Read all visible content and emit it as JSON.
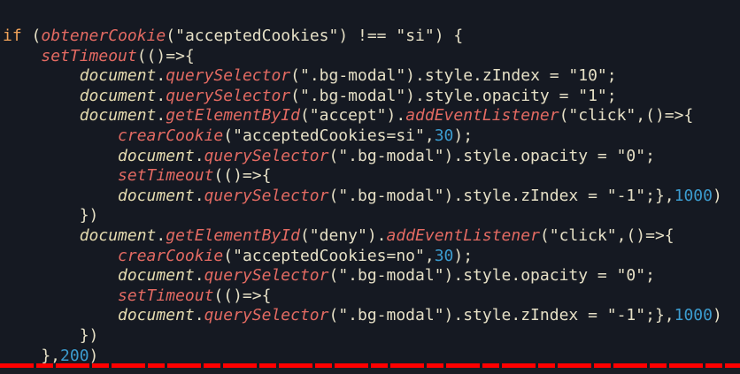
{
  "code_lines": [
    [
      [
        "kw",
        "if"
      ],
      [
        "pl",
        " ("
      ],
      [
        "fn",
        "obtenerCookie"
      ],
      [
        "pl",
        "(\"acceptedCookies\") !== \"si\") {"
      ]
    ],
    [
      [
        "pl",
        "    "
      ],
      [
        "fn",
        "setTimeout"
      ],
      [
        "pl",
        "(()=>{"
      ]
    ],
    [
      [
        "pl",
        "        "
      ],
      [
        "obj",
        "document"
      ],
      [
        "pl",
        "."
      ],
      [
        "fn",
        "querySelector"
      ],
      [
        "pl",
        "(\".bg-modal\").style.zIndex = \"10\";"
      ]
    ],
    [
      [
        "pl",
        "        "
      ],
      [
        "obj",
        "document"
      ],
      [
        "pl",
        "."
      ],
      [
        "fn",
        "querySelector"
      ],
      [
        "pl",
        "(\".bg-modal\").style.opacity = \"1\";"
      ]
    ],
    [
      [
        "pl",
        "        "
      ],
      [
        "obj",
        "document"
      ],
      [
        "pl",
        "."
      ],
      [
        "fn",
        "getElementById"
      ],
      [
        "pl",
        "(\"accept\")."
      ],
      [
        "fn",
        "addEventListener"
      ],
      [
        "pl",
        "(\"click\",()=>{"
      ]
    ],
    [
      [
        "pl",
        "            "
      ],
      [
        "fn",
        "crearCookie"
      ],
      [
        "pl",
        "(\"acceptedCookies=si\","
      ],
      [
        "num",
        "30"
      ],
      [
        "pl",
        ");"
      ]
    ],
    [
      [
        "pl",
        "            "
      ],
      [
        "obj",
        "document"
      ],
      [
        "pl",
        "."
      ],
      [
        "fn",
        "querySelector"
      ],
      [
        "pl",
        "(\".bg-modal\").style.opacity = \"0\";"
      ]
    ],
    [
      [
        "pl",
        "            "
      ],
      [
        "fn",
        "setTimeout"
      ],
      [
        "pl",
        "(()=>{"
      ]
    ],
    [
      [
        "pl",
        "            "
      ],
      [
        "obj",
        "document"
      ],
      [
        "pl",
        "."
      ],
      [
        "fn",
        "querySelector"
      ],
      [
        "pl",
        "(\".bg-modal\").style.zIndex = \"-1\";},"
      ],
      [
        "num",
        "1000"
      ],
      [
        "pl",
        ")"
      ]
    ],
    [
      [
        "pl",
        "        })"
      ]
    ],
    [
      [
        "pl",
        "        "
      ],
      [
        "obj",
        "document"
      ],
      [
        "pl",
        "."
      ],
      [
        "fn",
        "getElementById"
      ],
      [
        "pl",
        "(\"deny\")."
      ],
      [
        "fn",
        "addEventListener"
      ],
      [
        "pl",
        "(\"click\",()=>{"
      ]
    ],
    [
      [
        "pl",
        "            "
      ],
      [
        "fn",
        "crearCookie"
      ],
      [
        "pl",
        "(\"acceptedCookies=no\","
      ],
      [
        "num",
        "30"
      ],
      [
        "pl",
        ");"
      ]
    ],
    [
      [
        "pl",
        "            "
      ],
      [
        "obj",
        "document"
      ],
      [
        "pl",
        "."
      ],
      [
        "fn",
        "querySelector"
      ],
      [
        "pl",
        "(\".bg-modal\").style.opacity = \"0\";"
      ]
    ],
    [
      [
        "pl",
        "            "
      ],
      [
        "fn",
        "setTimeout"
      ],
      [
        "pl",
        "(()=>{"
      ]
    ],
    [
      [
        "pl",
        "            "
      ],
      [
        "obj",
        "document"
      ],
      [
        "pl",
        "."
      ],
      [
        "fn",
        "querySelector"
      ],
      [
        "pl",
        "(\".bg-modal\").style.zIndex = \"-1\";},"
      ],
      [
        "num",
        "1000"
      ],
      [
        "pl",
        ")"
      ]
    ],
    [
      [
        "pl",
        "        })"
      ]
    ],
    [
      [
        "pl",
        "    },"
      ],
      [
        "num",
        "200"
      ],
      [
        "pl",
        ")"
      ]
    ]
  ],
  "colors": {
    "background": "#151922",
    "keyword": "#f2a35a",
    "function": "#e36a62",
    "number": "#3c9ccf",
    "text": "#e6e0c6",
    "progress": "#ff0000"
  }
}
